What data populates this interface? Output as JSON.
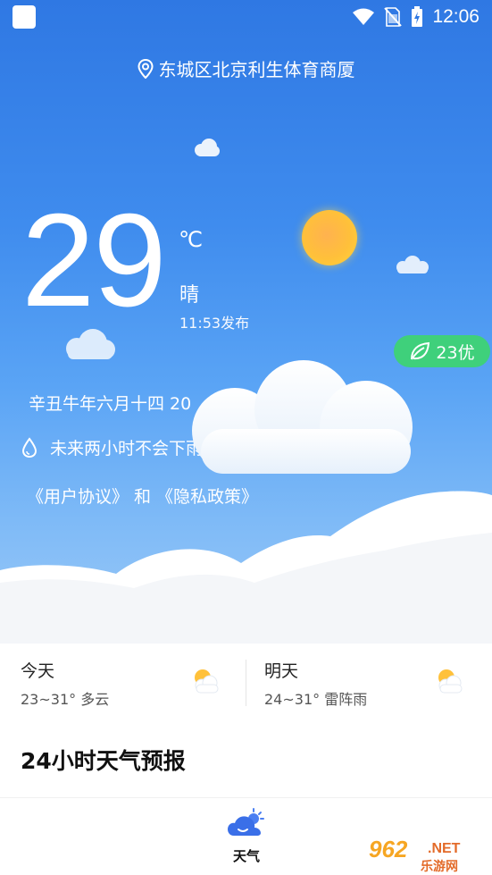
{
  "status_bar": {
    "time": "12:06"
  },
  "location": {
    "text": "东城区北京利生体育商厦"
  },
  "current": {
    "temperature": "29",
    "unit": "℃",
    "condition": "晴",
    "publish_time": "11:53发布",
    "aqi": "23优",
    "lunar_date": "辛丑牛年六月十四 20",
    "rain_forecast": "未来两小时不会下雨 >>"
  },
  "legal": {
    "user_agreement": "《用户协议》",
    "and": "和",
    "privacy_policy": "《隐私政策》"
  },
  "forecast": [
    {
      "day": "今天",
      "range": "23~31° 多云",
      "icon": "partly-cloudy-icon"
    },
    {
      "day": "明天",
      "range": "24~31° 雷阵雨",
      "icon": "partly-cloudy-icon"
    }
  ],
  "hourly": {
    "title": "24小时天气预报"
  },
  "tabbar": {
    "tabs": [
      {
        "label": "天气",
        "icon": "weather-tab-icon"
      }
    ]
  },
  "watermark": {
    "text": "962",
    "net": ".NET",
    "sub": "乐游网"
  },
  "colors": {
    "sky_top": "#2f78e3",
    "sky_bottom": "#9cc9f6",
    "aqi_badge": "#3fd07b",
    "sun": "#ffc03a"
  }
}
